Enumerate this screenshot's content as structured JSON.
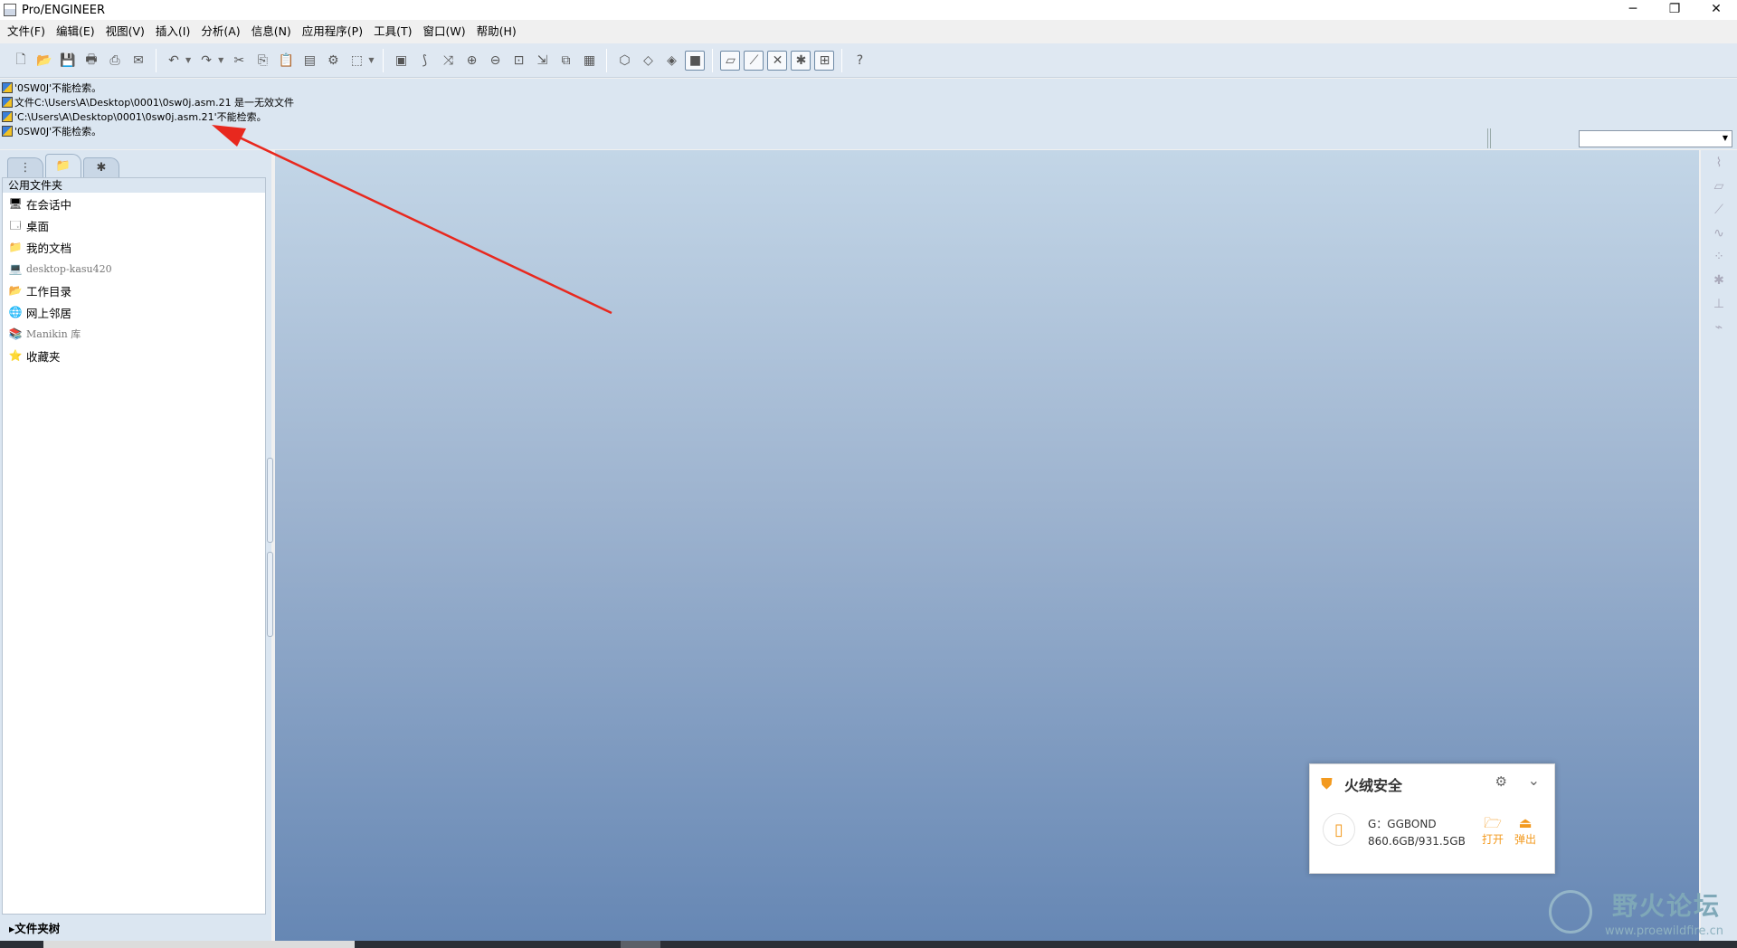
{
  "window": {
    "title": "Pro/ENGINEER",
    "controls": [
      "─",
      "❐",
      "✕"
    ]
  },
  "menu": [
    "文件(F)",
    "编辑(E)",
    "视图(V)",
    "插入(I)",
    "分析(A)",
    "信息(N)",
    "应用程序(P)",
    "工具(T)",
    "窗口(W)",
    "帮助(H)"
  ],
  "toolbar": {
    "groups": [
      [
        "new-icon",
        "open-icon",
        "save-icon",
        "print-icon",
        "print-preview-icon",
        "mail-icon"
      ],
      [
        "undo-icon",
        "redo-icon",
        "cut-icon",
        "copy-icon",
        "paste-icon",
        "paste-special-icon",
        "regenerate-icon",
        "select-box-icon"
      ],
      [
        "repaint-icon",
        "spin-center-icon",
        "orient-icon",
        "zoom-in-icon",
        "zoom-out-icon",
        "refit-icon",
        "reorient-icon",
        "saved-views-icon",
        "layers-icon"
      ],
      [
        "wireframe-icon",
        "hidden-line-icon",
        "no-hidden-icon",
        "shading-icon"
      ],
      [
        "datum-planes-icon",
        "datum-axes-icon",
        "datum-points-icon",
        "coord-sys-icon",
        "annotation-icon"
      ],
      [
        "context-help-icon"
      ]
    ],
    "glyphs": {
      "new-icon": "🗋",
      "open-icon": "📂",
      "save-icon": "💾",
      "print-icon": "🖶",
      "print-preview-icon": "⎙",
      "mail-icon": "✉",
      "undo-icon": "↶",
      "redo-icon": "↷",
      "cut-icon": "✂",
      "copy-icon": "⎘",
      "paste-icon": "📋",
      "paste-special-icon": "▤",
      "regenerate-icon": "⚙",
      "select-box-icon": "⬚",
      "repaint-icon": "▣",
      "spin-center-icon": "⟆",
      "orient-icon": "⤨",
      "zoom-in-icon": "⊕",
      "zoom-out-icon": "⊖",
      "refit-icon": "⊡",
      "reorient-icon": "⇲",
      "saved-views-icon": "⧉",
      "layers-icon": "▦",
      "wireframe-icon": "⬡",
      "hidden-line-icon": "◇",
      "no-hidden-icon": "◈",
      "shading-icon": "■",
      "datum-planes-icon": "▱",
      "datum-axes-icon": "⟋",
      "datum-points-icon": "✕",
      "coord-sys-icon": "✱",
      "annotation-icon": "⊞",
      "context-help-icon": "?"
    }
  },
  "messages": [
    "'0SW0J'不能检索。",
    "文件C:\\Users\\A\\Desktop\\0001\\0sw0j.asm.21 是一无效文件",
    "'C:\\Users\\A\\Desktop\\0001\\0sw0j.asm.21'不能检索。",
    "'0SW0J'不能检索。"
  ],
  "navigator": {
    "tabs": [
      "model-tree-tab",
      "folder-browser-tab",
      "favorites-tab"
    ],
    "panel_title": "公用文件夹",
    "folders": [
      {
        "label": "在会话中",
        "icon": "monitor-icon",
        "glyph": "🖥",
        "mono": false
      },
      {
        "label": "桌面",
        "icon": "desktop-icon",
        "glyph": "🗔",
        "mono": false
      },
      {
        "label": "我的文档",
        "icon": "documents-icon",
        "glyph": "📁",
        "mono": false
      },
      {
        "label": "desktop-kasu420",
        "icon": "computer-icon",
        "glyph": "💻",
        "mono": true
      },
      {
        "label": "工作目录",
        "icon": "working-dir-icon",
        "glyph": "📂",
        "mono": false
      },
      {
        "label": "网上邻居",
        "icon": "network-icon",
        "glyph": "🌐",
        "mono": false
      },
      {
        "label": "Manikin 库",
        "icon": "manikin-icon",
        "glyph": "📚",
        "mono": true
      },
      {
        "label": "收藏夹",
        "icon": "favorites-icon",
        "glyph": "⭐",
        "mono": false
      }
    ],
    "tree_toggle": "▸文件夹树"
  },
  "popup": {
    "title": "火绒安全",
    "drive_name": "G：GGBOND",
    "drive_size": "860.6GB/931.5GB",
    "open_label": "打开",
    "eject_label": "弹出",
    "accent": "#f39a1f"
  },
  "watermark": {
    "text": "野火论坛",
    "url": "www.proewildfire.cn"
  },
  "annotation": {
    "color": "#e8281e"
  }
}
